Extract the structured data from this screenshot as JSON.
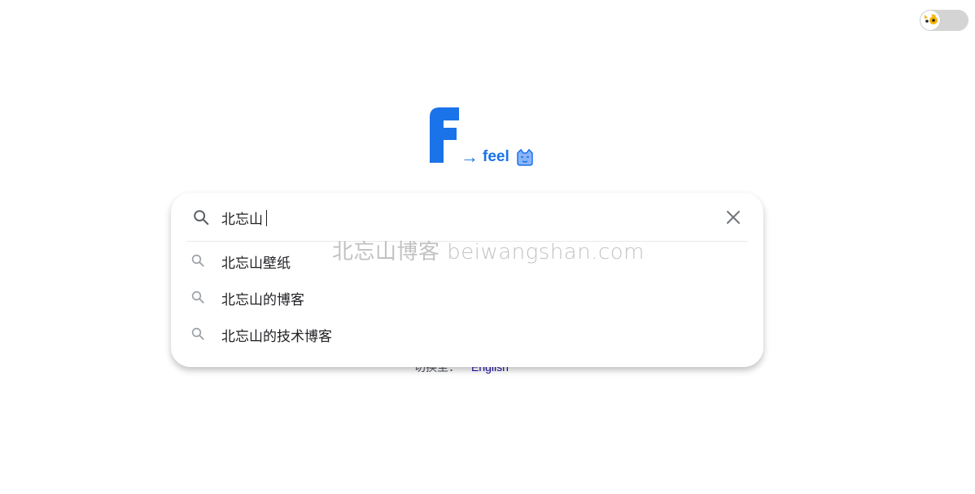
{
  "theme_toggle": {
    "icon": "dog-icon",
    "state": "off"
  },
  "logo": {
    "letter": "F",
    "arrow": "→",
    "tagline": "feel",
    "icon": "cat-face-icon",
    "color": "#1a73e8"
  },
  "search": {
    "value": "北忘山",
    "icon": "search-icon",
    "clear_icon": "close-icon"
  },
  "suggestions": [
    {
      "text": "北忘山壁纸"
    },
    {
      "text": "北忘山的博客"
    },
    {
      "text": "北忘山的技术博客"
    }
  ],
  "language": {
    "label": "切换至：",
    "link": "English",
    "link_color": "#1a0dab"
  },
  "watermark": "北忘山博客 beiwangshan.com"
}
